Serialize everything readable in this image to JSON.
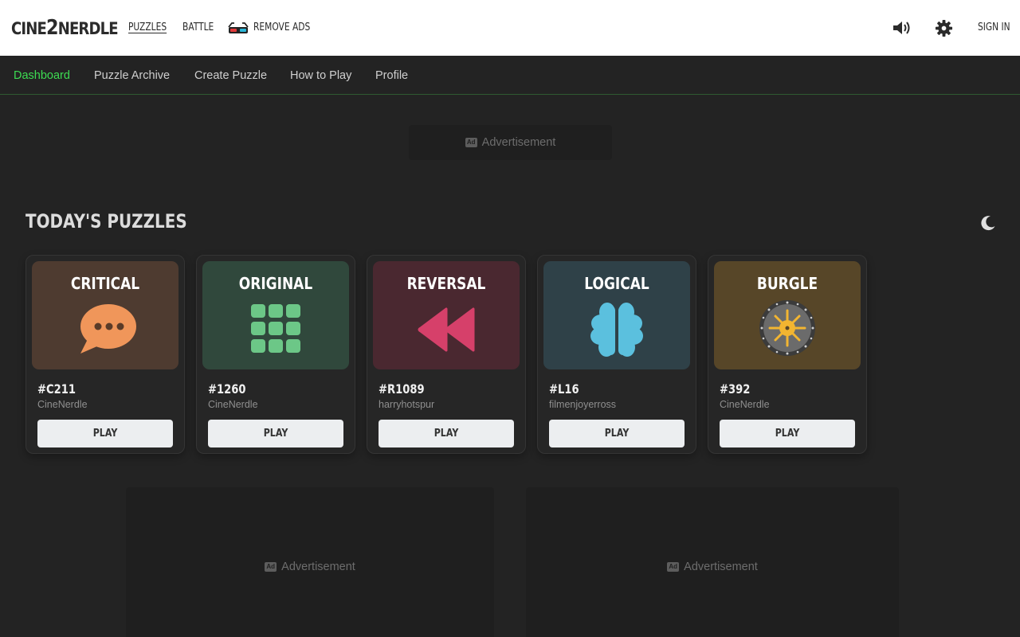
{
  "brand": {
    "logo_left": "CINE",
    "logo_mid": "2",
    "logo_right": "NERDLE"
  },
  "topnav": {
    "puzzles": "PUZZLES",
    "battle": "BATTLE",
    "remove_ads": "REMOVE ADS",
    "sign_in": "SIGN IN"
  },
  "subnav": {
    "items": [
      "Dashboard",
      "Puzzle Archive",
      "Create Puzzle",
      "How to Play",
      "Profile"
    ],
    "active": "Dashboard"
  },
  "ads": {
    "label": "Advertisement",
    "icon_text": "Ad"
  },
  "section": {
    "title": "TODAY'S PUZZLES"
  },
  "puzzles": [
    {
      "title": "CRITICAL",
      "number": "#C211",
      "author": "CineNerdle",
      "play": "PLAY",
      "icon": "speech-bubble-icon",
      "color": "#4e3b30"
    },
    {
      "title": "ORIGINAL",
      "number": "#1260",
      "author": "CineNerdle",
      "play": "PLAY",
      "icon": "grid-icon",
      "color": "#30483c"
    },
    {
      "title": "REVERSAL",
      "number": "#R1089",
      "author": "harryhotspur",
      "play": "PLAY",
      "icon": "rewind-icon",
      "color": "#4a2830"
    },
    {
      "title": "LOGICAL",
      "number": "#L16",
      "author": "filmenjoyerross",
      "play": "PLAY",
      "icon": "brain-icon",
      "color": "#2f4148"
    },
    {
      "title": "BURGLE",
      "number": "#392",
      "author": "CineNerdle",
      "play": "PLAY",
      "icon": "vault-icon",
      "color": "#574628"
    }
  ],
  "colors": {
    "accent": "#3ddc52",
    "background": "#232323",
    "card": "#262626"
  }
}
